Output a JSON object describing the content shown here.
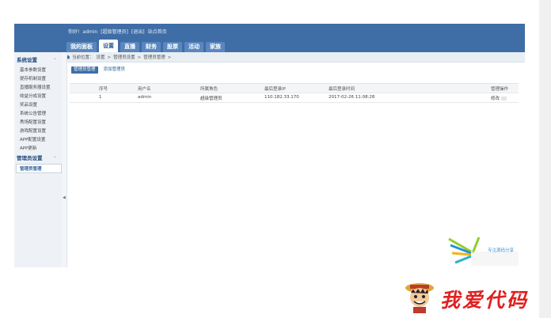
{
  "header": {
    "greeting": "你好!",
    "user": "admin",
    "role_tag": "[超级管理员]",
    "logout": "[退出]",
    "site_home": "站点首页"
  },
  "nav": {
    "tabs": [
      "我的面板",
      "设置",
      "直播",
      "财务",
      "股票",
      "活动",
      "家族"
    ],
    "active_index": 1
  },
  "breadcrumb": {
    "label": "当前位置：",
    "items": [
      "设置",
      ">",
      "管理员设置",
      ">",
      "管理员管理",
      ">"
    ]
  },
  "sidebar": {
    "section1": {
      "title": "系统设置",
      "items": [
        "基本参数设置",
        "提存机制设置",
        "直播服务器设置",
        "收益分成设置",
        "奖品设置",
        "系统公告管理",
        "秀场配置设置",
        "游戏配置设置",
        "APP配置设置",
        "APP更新"
      ]
    },
    "section2": {
      "title": "管理员设置",
      "items": [
        "管理员管理"
      ]
    }
  },
  "subtabs": [
    "管理员管理",
    "添加管理员"
  ],
  "table": {
    "headers": [
      "序号",
      "用户名",
      "所属角色",
      "最后登录IP",
      "最后登录时间",
      "管理操作"
    ],
    "rows": [
      [
        "1",
        "admin",
        "超级管理员",
        "110.182.33.170",
        "2017-02-26 11:08:28",
        "修改"
      ]
    ]
  },
  "watermark": {
    "tagline": "专注源码分享",
    "brand": "我爱代码"
  },
  "colors": {
    "header": "#3f6ea6",
    "accent": "#2d5f98",
    "brand_red": "#e02020"
  }
}
